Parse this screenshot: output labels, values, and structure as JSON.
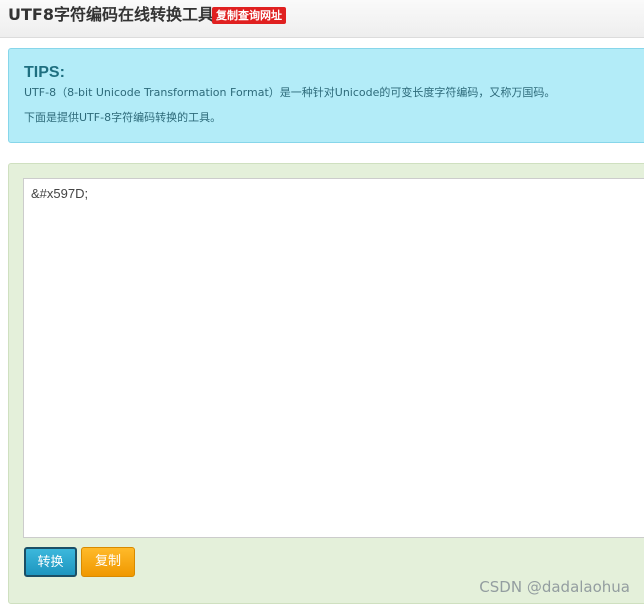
{
  "header": {
    "title": "UTF8字符编码在线转换工具",
    "copy_link_label": "复制查询网址",
    "badge_color": "#e02020"
  },
  "tips": {
    "heading": "TIPS:",
    "line1": "UTF-8（8-bit Unicode Transformation Format）是一种针对Unicode的可变长度字符编码，又称万国码。",
    "line2": "下面是提供UTF-8字符编码转换的工具。",
    "background_color": "#b3ecf8"
  },
  "tool": {
    "input_value": "&#x597D;",
    "convert_label": "转换",
    "copy_label": "复制",
    "panel_color": "#e4f0da",
    "convert_color": "#1d95bf",
    "copy_color": "#f09800"
  },
  "watermark": {
    "text": "CSDN @dadalaohua"
  }
}
